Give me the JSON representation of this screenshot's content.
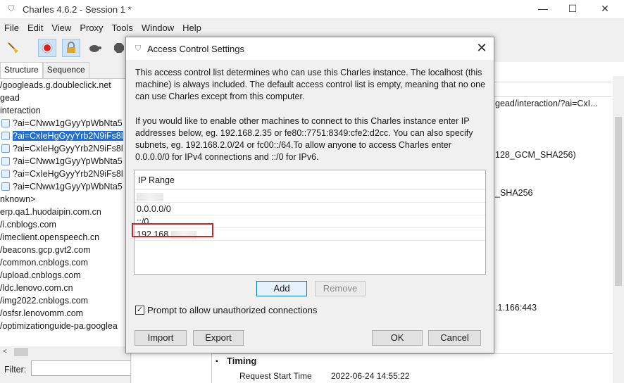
{
  "window": {
    "title": "Charles 4.6.2 - Session 1 *",
    "minimize": "—",
    "maximize": "☐",
    "close": "✕"
  },
  "menu": [
    "File",
    "Edit",
    "View",
    "Proxy",
    "Tools",
    "Window",
    "Help"
  ],
  "left": {
    "tabs": [
      "Structure",
      "Sequence"
    ],
    "tree": [
      {
        "text": "/googleads.g.doubleclick.net",
        "icon": false
      },
      {
        "text": "gead",
        "icon": false
      },
      {
        "text": "interaction",
        "icon": false
      },
      {
        "text": "?ai=CNww1gGyyYpWbNta5",
        "icon": true
      },
      {
        "text": "?ai=CxIeHgGyyYrb2N9iFs8l",
        "icon": true,
        "selected": true
      },
      {
        "text": "?ai=CxIeHgGyyYrb2N9iFs8l",
        "icon": true
      },
      {
        "text": "?ai=CNww1gGyyYpWbNta5",
        "icon": true
      },
      {
        "text": "?ai=CxIeHgGyyYrb2N9iFs8l",
        "icon": true
      },
      {
        "text": "?ai=CNww1gGyyYpWbNta5",
        "icon": true
      },
      {
        "text": "nknown>",
        "icon": false
      },
      {
        "text": "erp.qa1.huodaipin.com.cn",
        "icon": false
      },
      {
        "text": "/i.cnblogs.com",
        "icon": false
      },
      {
        "text": "/imeclient.openspeech.cn",
        "icon": false
      },
      {
        "text": "/beacons.gcp.gvt2.com",
        "icon": false
      },
      {
        "text": "/common.cnblogs.com",
        "icon": false
      },
      {
        "text": "/upload.cnblogs.com",
        "icon": false
      },
      {
        "text": "/ldc.lenovo.com.cn",
        "icon": false
      },
      {
        "text": "/img2022.cnblogs.com",
        "icon": false
      },
      {
        "text": "/osfsr.lenovomm.com",
        "icon": false
      },
      {
        "text": "/optimizationguide-pa.googlea",
        "icon": false
      }
    ],
    "filter_label": "Filter:",
    "filter_value": ""
  },
  "right": {
    "url_fragment": "gead/interaction/?ai=CxI...",
    "cipher1": "128_GCM_SHA256)",
    "cipher2": "_SHA256",
    "port": ".1.166:443",
    "timing_header": "Timing",
    "timing_row_label": "Request Start Time",
    "timing_row_value": "2022-06-24 14:55:22"
  },
  "dialog": {
    "title": "Access Control Settings",
    "paragraph1": "This access control list determines who can use this Charles instance. The localhost (this machine) is always included. The default access control list is empty, meaning that no one can use Charles except from this computer.",
    "paragraph2": "If you would like to enable other machines to connect to this Charles instance enter IP addresses below, eg. 192.168.2.35 or fe80::7751:8349:cfe2:d2cc. You can also specify subnets, eg. 192.168.2.0/24 or fc00::/64.To allow anyone to access Charles enter 0.0.0.0/0 for IPv4 connections and ::/0 for IPv6.",
    "list_header": "IP Range",
    "rows": [
      "192.168",
      "0.0.0.0/0",
      "::/0",
      "192.168"
    ],
    "add_label": "Add",
    "remove_label": "Remove",
    "checkbox_label": "Prompt to allow unauthorized connections",
    "checkbox_checked": "✓",
    "import_label": "Import",
    "export_label": "Export",
    "ok_label": "OK",
    "cancel_label": "Cancel"
  }
}
